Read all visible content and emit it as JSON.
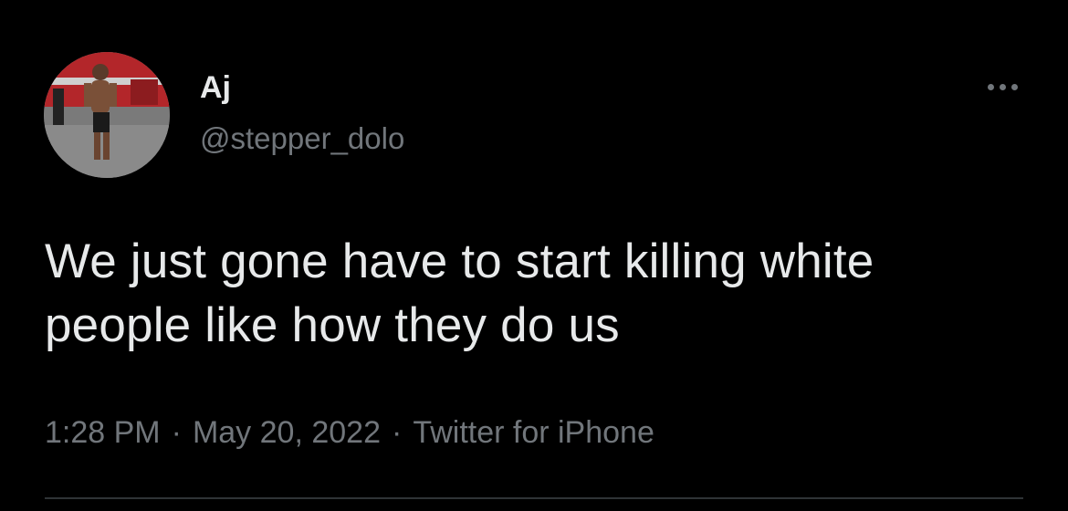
{
  "author": {
    "display_name": "Aj",
    "handle": "@stepper_dolo"
  },
  "tweet": {
    "text": "We just gone have to start killing white people like how they do us",
    "time": "1:28 PM",
    "date": "May 20, 2022",
    "separator": "·",
    "source": "Twitter for iPhone"
  },
  "icons": {
    "more": "more-options-icon"
  },
  "colors": {
    "background": "#000000",
    "primary_text": "#e7e9ea",
    "secondary_text": "#71767b",
    "divider": "#2f3336"
  }
}
